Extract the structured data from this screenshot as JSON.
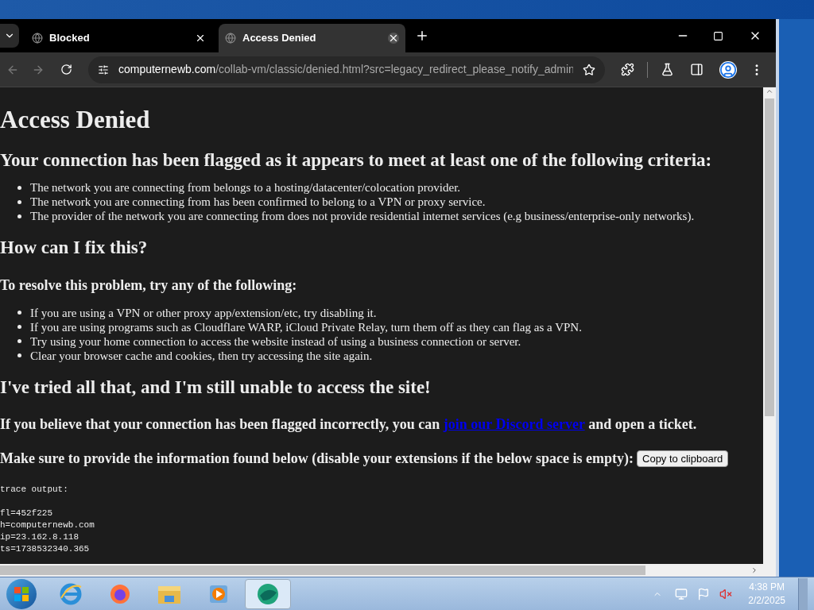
{
  "browser": {
    "tabs": [
      {
        "title": "Blocked",
        "selected": false
      },
      {
        "title": "Access Denied",
        "selected": true
      }
    ],
    "address": {
      "host": "computernewb.com",
      "path": "/collab-vm/classic/denied.html?src=legacy_redirect_please_notify_admin"
    }
  },
  "page": {
    "title": "Access Denied",
    "criteria_heading": "Your connection has been flagged as it appears to meet at least one of the following criteria:",
    "criteria": [
      "The network you are connecting from belongs to a hosting/datacenter/colocation provider.",
      "The network you are connecting from has been confirmed to belong to a VPN or proxy service.",
      "The provider of the network you are connecting from does not provide residential internet services (e.g business/enterprise-only networks)."
    ],
    "fix_heading": "How can I fix this?",
    "fix_subheading": "To resolve this problem, try any of the following:",
    "fixes": [
      "If you are using a VPN or other proxy app/extension/etc, try disabling it.",
      "If you are using programs such as Cloudflare WARP, iCloud Private Relay, turn them off as they can flag as a VPN.",
      "Try using your home connection to access the website instead of using a business connection or server.",
      "Clear your browser cache and cookies, then try accessing the site again."
    ],
    "tried_heading": "I've tried all that, and I'm still unable to access the site!",
    "ticket": {
      "before": "If you believe that your connection has been flagged incorrectly, you can",
      "link": "join our Discord server",
      "after": "and open a ticket."
    },
    "info_text": "Make sure to provide the information found below (disable your extensions if the below space is empty):",
    "copy_button": "Copy to clipboard",
    "trace_label": "trace output:",
    "trace": [
      "fl=452f225",
      "h=computernewb.com",
      "ip=23.162.8.118",
      "ts=1738532340.365"
    ]
  },
  "taskbar": {
    "time": "4:38 PM",
    "date": "2/2/2025"
  }
}
